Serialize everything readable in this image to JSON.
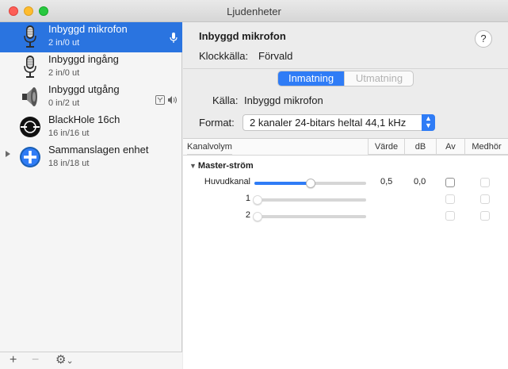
{
  "window": {
    "title": "Ljudenheter"
  },
  "sidebar": {
    "devices": [
      {
        "name": "Inbyggd mikrofon",
        "channels": "2 in/0 ut",
        "icon": "microphone-icon",
        "selected": true
      },
      {
        "name": "Inbyggd ingång",
        "channels": "2 in/0 ut",
        "icon": "microphone-icon",
        "selected": false
      },
      {
        "name": "Inbyggd utgång",
        "channels": "0 in/2 ut",
        "icon": "speaker-icon",
        "selected": false
      },
      {
        "name": "BlackHole 16ch",
        "channels": "16 in/16 ut",
        "icon": "blackhole-icon",
        "selected": false
      },
      {
        "name": "Sammanslagen enhet",
        "channels": "18 in/18 ut",
        "icon": "aggregate-device-icon",
        "selected": false
      }
    ],
    "footer": {
      "add": "+",
      "remove": "−",
      "gear": "⚙",
      "chevron": "⌄"
    }
  },
  "detail": {
    "title": "Inbyggd mikrofon",
    "help": "?",
    "clock_label": "Klockkälla:",
    "clock_value": "Förvald",
    "tabs": {
      "input": "Inmatning",
      "output": "Utmatning",
      "active": "input"
    },
    "source_label": "Källa:",
    "source_value": "Inbyggd mikrofon",
    "format_label": "Format:",
    "format_value": "2 kanaler 24-bitars heltal 44,1 kHz",
    "table": {
      "headers": {
        "volume": "Kanalvolym",
        "value": "Värde",
        "db": "dB",
        "mute": "Av",
        "thru": "Medhör"
      },
      "group": "Master-ström",
      "rows": [
        {
          "label": "Huvudkanal",
          "level": 0.5,
          "value": "0,5",
          "db": "0,0",
          "enabled": true
        },
        {
          "label": "1",
          "level": 0,
          "value": "",
          "db": "",
          "enabled": false
        },
        {
          "label": "2",
          "level": 0,
          "value": "",
          "db": "",
          "enabled": false
        }
      ]
    }
  },
  "colors": {
    "accent": "#2f7cf6",
    "selection": "#2a74e0"
  }
}
